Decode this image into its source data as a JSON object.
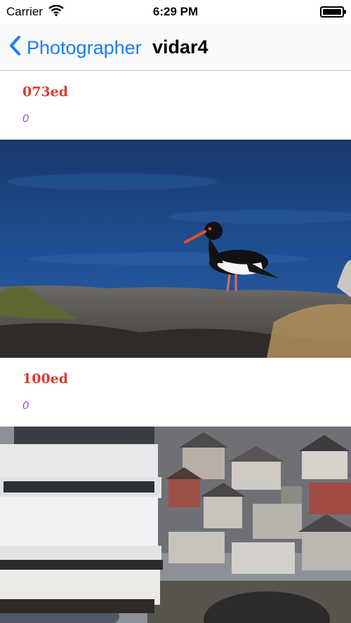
{
  "status": {
    "carrier": "Carrier",
    "time": "6:29 PM"
  },
  "nav": {
    "back_label": "Photographer",
    "title": "vidar4"
  },
  "items": [
    {
      "title": "073ed",
      "subtitle": "0",
      "photo": "oystercatcher-bird-photo"
    },
    {
      "title": "100ed",
      "subtitle": "0",
      "photo": "ship-harbor-town-photo"
    }
  ],
  "colors": {
    "tint": "#1a7ef7",
    "title_red": "#dc3a2c",
    "subtitle_purple": "#a44ccf"
  }
}
